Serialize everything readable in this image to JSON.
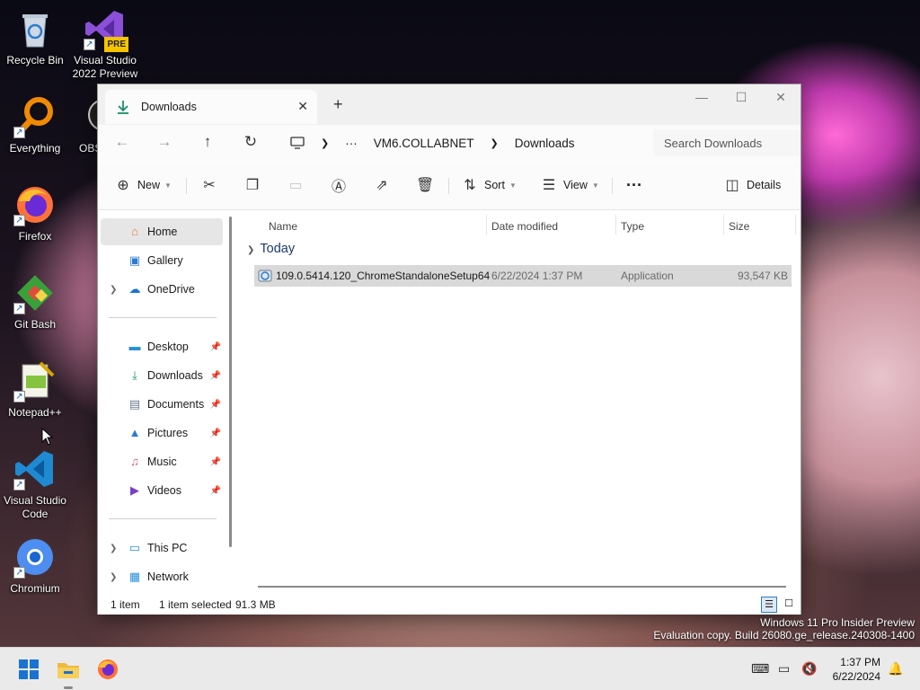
{
  "desktop": {
    "icons": [
      {
        "label": "Recycle Bin",
        "icon": "recycle-bin-icon"
      },
      {
        "label": "Visual Studio\n2022 Preview",
        "icon": "visual-studio-icon",
        "badge": "PRE"
      },
      {
        "label": "Everything",
        "icon": "everything-search-icon"
      },
      {
        "label": "OBS",
        "icon": "obs-icon"
      },
      {
        "label": "Firefox",
        "icon": "firefox-icon"
      },
      {
        "label": "Git Bash",
        "icon": "git-bash-icon"
      },
      {
        "label": "Notepad++",
        "icon": "notepad-plus-plus-icon"
      },
      {
        "label": "Visual Studio\nCode",
        "icon": "vscode-icon"
      },
      {
        "label": "Chromium",
        "icon": "chromium-icon"
      }
    ]
  },
  "explorer": {
    "tab_title": "Downloads",
    "address": {
      "path": [
        "VM6.COLLABNET",
        "Downloads"
      ],
      "ellipsis": "···",
      "search_placeholder": "Search Downloads"
    },
    "toolbar": {
      "new_label": "New",
      "sort_label": "Sort",
      "view_label": "View",
      "more_label": "···",
      "details_label": "Details"
    },
    "sidebar": {
      "top": [
        {
          "label": "Home",
          "icon": "home-icon",
          "selected": true
        },
        {
          "label": "Gallery",
          "icon": "gallery-icon"
        },
        {
          "label": "OneDrive",
          "icon": "onedrive-icon",
          "expandable": true
        }
      ],
      "pinned": [
        {
          "label": "Desktop",
          "icon": "desktop-folder-icon"
        },
        {
          "label": "Downloads",
          "icon": "downloads-icon"
        },
        {
          "label": "Documents",
          "icon": "documents-icon"
        },
        {
          "label": "Pictures",
          "icon": "pictures-icon"
        },
        {
          "label": "Music",
          "icon": "music-icon"
        },
        {
          "label": "Videos",
          "icon": "videos-icon"
        }
      ],
      "bottom": [
        {
          "label": "This PC",
          "icon": "this-pc-icon"
        },
        {
          "label": "Network",
          "icon": "network-icon"
        }
      ]
    },
    "columns": {
      "name": "Name",
      "date": "Date modified",
      "type": "Type",
      "size": "Size"
    },
    "group_label": "Today",
    "files": [
      {
        "name": "109.0.5414.120_ChromeStandaloneSetup64",
        "date": "6/22/2024 1:37 PM",
        "type": "Application",
        "size": "93,547 KB",
        "selected": true
      }
    ],
    "status": {
      "count": "1 item",
      "selection": "1 item selected",
      "size": "91.3 MB"
    }
  },
  "watermark": {
    "line1": "Windows 11 Pro Insider Preview",
    "line2": "Evaluation copy. Build 26080.ge_release.240308-1400"
  },
  "taskbar": {
    "time": "1:37 PM",
    "date": "6/22/2024"
  },
  "colors": {
    "accent": "#0067c0",
    "selection": "#d9d9d9",
    "taskbar": "#eaeaea"
  }
}
